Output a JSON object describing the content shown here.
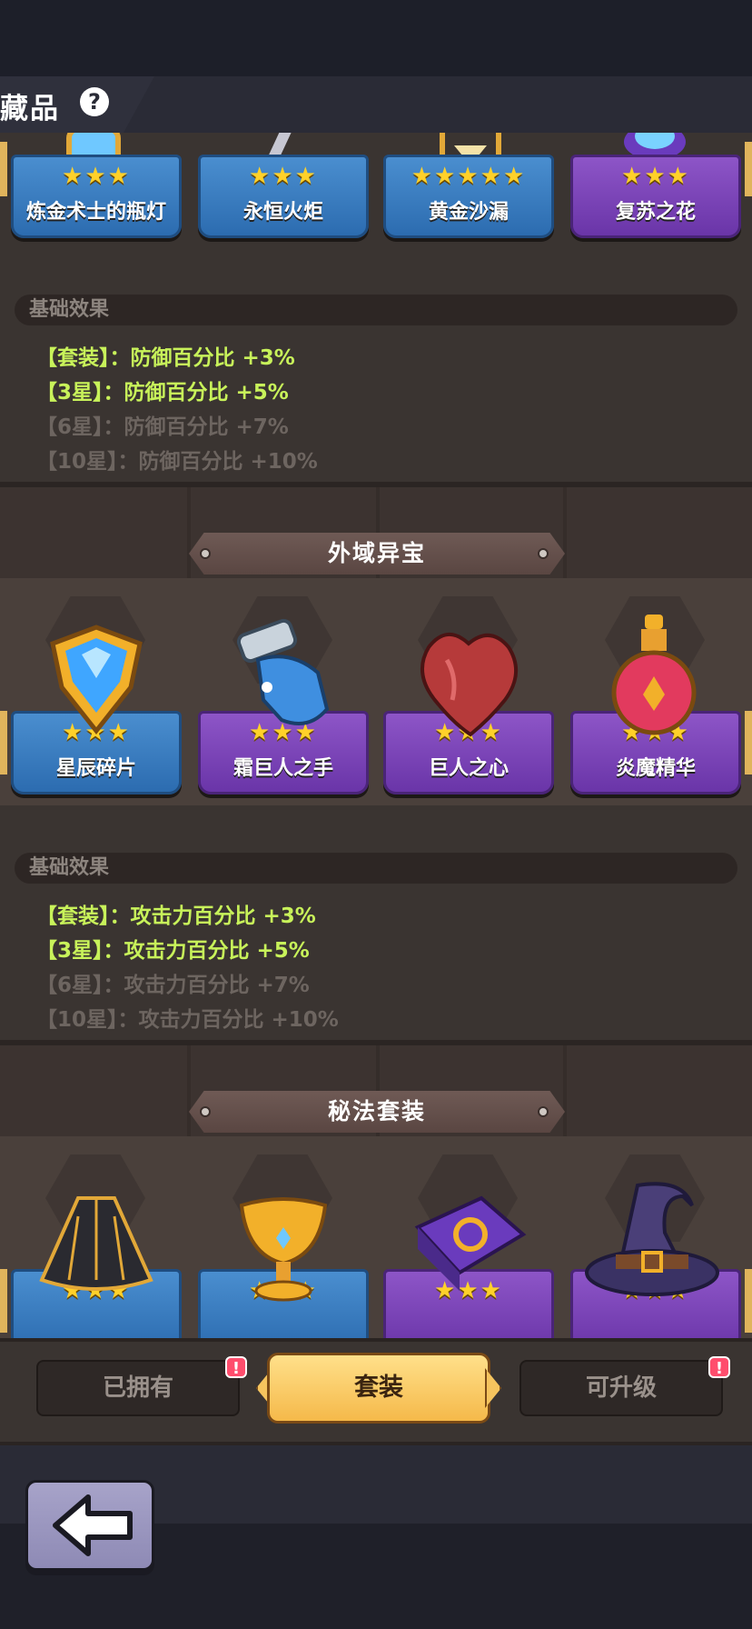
{
  "header": {
    "title": "藏品",
    "help_symbol": "?"
  },
  "sections": [
    {
      "title": "",
      "items": [
        {
          "name": "炼金术士的瓶灯",
          "stars": "★★★",
          "color": "blue",
          "icon": "lamp-icon"
        },
        {
          "name": "永恒火炬",
          "stars": "★★★",
          "color": "blue",
          "icon": "torch-icon"
        },
        {
          "name": "黄金沙漏",
          "stars": "★★★★★",
          "color": "blue",
          "icon": "hourglass-icon"
        },
        {
          "name": "复苏之花",
          "stars": "★★★",
          "color": "purple",
          "icon": "flower-icon"
        }
      ],
      "effect_header": "基础效果",
      "effects": [
        {
          "text": "【套装】：防御百分比 +3%",
          "active": true
        },
        {
          "text": "【3星】：防御百分比 +5%",
          "active": true
        },
        {
          "text": "【6星】：防御百分比 +7%",
          "active": false
        },
        {
          "text": "【10星】：防御百分比 +10%",
          "active": false
        }
      ]
    },
    {
      "title": "外域异宝",
      "items": [
        {
          "name": "星辰碎片",
          "stars": "★★★",
          "color": "blue",
          "icon": "gem-icon"
        },
        {
          "name": "霜巨人之手",
          "stars": "★★★",
          "color": "purple",
          "icon": "gauntlet-icon"
        },
        {
          "name": "巨人之心",
          "stars": "★★★",
          "color": "purple",
          "icon": "heart-icon"
        },
        {
          "name": "炎魔精华",
          "stars": "★★★",
          "color": "purple",
          "icon": "potion-icon"
        }
      ],
      "effect_header": "基础效果",
      "effects": [
        {
          "text": "【套装】：攻击力百分比 +3%",
          "active": true
        },
        {
          "text": "【3星】：攻击力百分比 +5%",
          "active": true
        },
        {
          "text": "【6星】：攻击力百分比 +7%",
          "active": false
        },
        {
          "text": "【10星】：攻击力百分比 +10%",
          "active": false
        }
      ]
    },
    {
      "title": "秘法套装",
      "items": [
        {
          "name": "",
          "stars": "★★★",
          "color": "blue",
          "icon": "cloak-icon"
        },
        {
          "name": "",
          "stars": "★★★",
          "color": "blue",
          "icon": "chalice-icon"
        },
        {
          "name": "",
          "stars": "★★★",
          "color": "purple",
          "icon": "spellbook-icon"
        },
        {
          "name": "",
          "stars": "★★★",
          "color": "purple",
          "icon": "witch-hat-icon"
        }
      ]
    }
  ],
  "tabs": {
    "owned": "已拥有",
    "sets": "套装",
    "upgradable": "可升级",
    "badge": "!"
  },
  "colors": {
    "active_effect": "#c8f25a",
    "inactive_effect": "#6d6560",
    "blue_card": "#2c6cb0",
    "purple_card": "#6a35a8",
    "star": "#ffd12a"
  }
}
